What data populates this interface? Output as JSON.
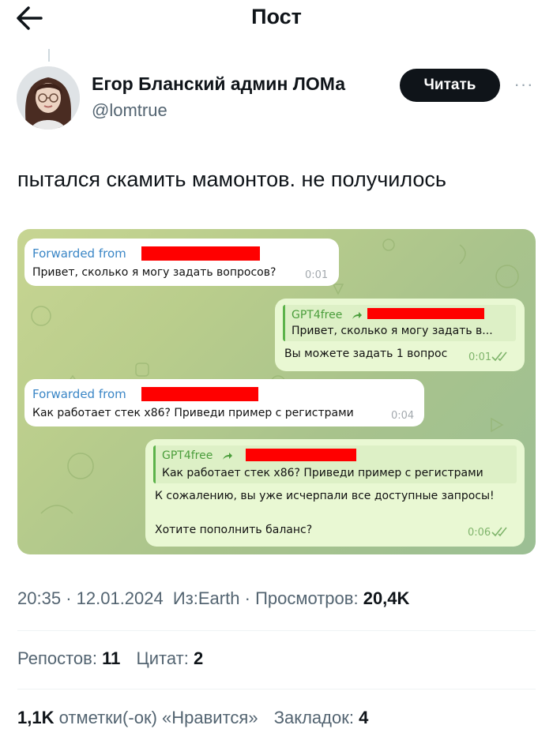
{
  "header": {
    "title": "Пост"
  },
  "author": {
    "name": "Егор Бланский админ ЛОМа",
    "handle": "@lomtrue",
    "follow_label": "Читать",
    "more": "···"
  },
  "post": {
    "text": "пытался скамить мамонтов. не получилось"
  },
  "chat": {
    "messages": [
      {
        "forward_label": "Forwarded from",
        "text": "Привет, сколько я могу задать вопросов?",
        "time": "0:01"
      },
      {
        "quote_name": "GPT4free",
        "quote_text": "Привет, сколько я могу задать в...",
        "text": "Вы можете задать 1 вопрос",
        "time": "0:01"
      },
      {
        "forward_label": "Forwarded from",
        "text": "Как работает стек x86? Приведи пример с регистрами",
        "time": "0:04"
      },
      {
        "quote_name": "GPT4free",
        "quote_text": "Как работает стек x86? Приведи пример с регистрами",
        "text": "К сожалению, вы уже исчерпали все доступные запросы!",
        "text2": "Хотите пополнить баланс?",
        "time": "0:06"
      }
    ]
  },
  "meta": {
    "time": "20:35",
    "date": "12.01.2024",
    "from": "Из:Earth",
    "views_label": "Просмотров:",
    "views": "20,4K"
  },
  "stats": {
    "reposts_label": "Репостов:",
    "reposts": "11",
    "quotes_label": "Цитат:",
    "quotes": "2",
    "likes": "1,1K",
    "likes_label": "отметки(-ок) «Нравится»",
    "bookmarks_label": "Закладок:",
    "bookmarks": "4"
  },
  "colors": {
    "text": "#0f1419",
    "muted": "#536471",
    "telegram_link": "#3a86c6",
    "redaction": "#ff0000"
  }
}
